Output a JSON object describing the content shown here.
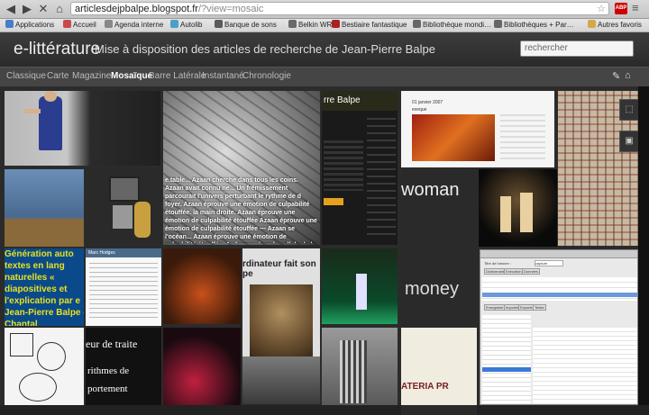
{
  "browser": {
    "url_host": "articlesdejpbalpe.blogspot.fr",
    "url_path": "/?view=mosaic",
    "extension_badge": "ABP"
  },
  "bookmarks": [
    {
      "label": "Applications",
      "icon_color": "#4a7dc9"
    },
    {
      "label": "Accueil",
      "icon_color": "#c94a4a"
    },
    {
      "label": "Agenda interne",
      "icon_color": "#888888"
    },
    {
      "label": "Autolib",
      "icon_color": "#4aa0c9"
    },
    {
      "label": "Banque de sons",
      "icon_color": "#5a5a5a"
    },
    {
      "label": "Belkin WRX",
      "icon_color": "#6a6a6a"
    },
    {
      "label": "Bestiaire fantastique",
      "icon_color": "#aa2222"
    },
    {
      "label": "Bibliothèque mondi…",
      "icon_color": "#666666"
    },
    {
      "label": "Bibliothèques + Par…",
      "icon_color": "#666666"
    },
    {
      "label": "Autres favoris",
      "icon_color": "#d4a84a"
    }
  ],
  "site": {
    "title": "e-littérature",
    "description": "Mise à disposition des articles de recherche de Jean-Pierre Balpe",
    "search_placeholder": "rechercher"
  },
  "views": [
    "Classique",
    "Carte",
    "Magazine",
    "Mosaïque",
    "Barre Latérale",
    "Instantané",
    "Chronologie"
  ],
  "active_view": "Mosaïque",
  "tiles": {
    "t3_heading": "rre Balpe",
    "t4_date": "01 janvier 2007",
    "t4_title": "exeque",
    "t5_text": "e.table... Azaan cherche dans tous les coins. Azaan avait connu ne... Un frémissement parcourait l'univers perturbant le rythme de d foyer. Azaan éprouve une émotion de culpabilité étouffée. la main droite. Azaan éprouve une émotion de culpabilité étouffée Azaan éprouve une émotion de culpabilité étouffée — Azaan se l'océan... Azaan éprouve une émotion de culpabilité étouffée. Az fermer dans la cellule de la langue. Azaan se sent comme une couteau, songeur, regardant le reflet lent de la vie. Le choral s trouve des incidences. Candy fut elle tout d'amour, d'au- re la vérité, pitre.",
    "t_gen_text": "Génération auto textes en lang naturelles « diapositives et l'explication par e Jean-Pierre Balpe - Chantal",
    "t_marc": "Marc Hodges",
    "t_ordinateur": "rdinateur fait son pe",
    "t_woman": "woman",
    "t_money": "money",
    "t_traite": "eur de traite",
    "t_rithmes": "rithmes de",
    "t_portement": "portement",
    "t_materia": "ATERIA PR"
  },
  "overlay": {
    "title_label": "Titre de l'œuvre :",
    "title_value": "capture",
    "tabs": [
      "Dictionnaire",
      "Exécution",
      "Données"
    ],
    "buttons": [
      "Enregistrer",
      "Importer",
      "Exporter",
      "Tester"
    ]
  }
}
